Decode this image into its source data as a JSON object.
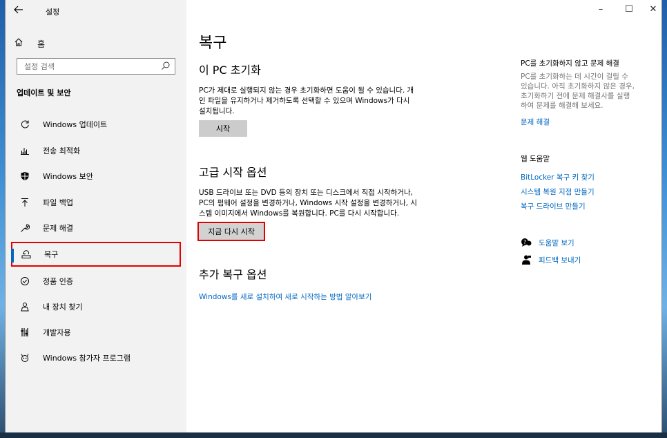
{
  "window": {
    "title": "설정",
    "back_icon": "arrow-left-icon",
    "minimize_glyph": "–",
    "maximize_glyph": "☐",
    "close_glyph": "✕"
  },
  "sidebar": {
    "home": {
      "label": "홈",
      "icon": "home-icon"
    },
    "search": {
      "placeholder": "설정 검색",
      "icon": "search-icon"
    },
    "section_title": "업데이트 및 보안",
    "items": [
      {
        "label": "Windows 업데이트",
        "icon": "sync-icon",
        "active": false
      },
      {
        "label": "전송 최적화",
        "icon": "delivery-icon",
        "active": false
      },
      {
        "label": "Windows 보안",
        "icon": "shield-icon",
        "active": false
      },
      {
        "label": "파일 백업",
        "icon": "backup-arrow-icon",
        "active": false
      },
      {
        "label": "문제 해결",
        "icon": "wrench-icon",
        "active": false
      },
      {
        "label": "복구",
        "icon": "recovery-icon",
        "active": true
      },
      {
        "label": "정품 인증",
        "icon": "check-circle-icon",
        "active": false
      },
      {
        "label": "내 장치 찾기",
        "icon": "find-device-icon",
        "active": false
      },
      {
        "label": "개발자용",
        "icon": "developer-icon",
        "active": false
      },
      {
        "label": "Windows 참가자 프로그램",
        "icon": "insider-icon",
        "active": false
      }
    ]
  },
  "main": {
    "title": "복구",
    "reset": {
      "heading": "이 PC 초기화",
      "description_lines": [
        "PC가 제대로 실행되지 않는 경우 초기화하면 도움이 될 수 있습니다. 개",
        "인 파일을 유지하거나 제거하도록 선택할 수 있으며 Windows가 다시",
        "설치됩니다."
      ],
      "button": "시작"
    },
    "advanced": {
      "heading": "고급 시작 옵션",
      "description_lines": [
        "USB 드라이브 또는 DVD 등의 장치 또는 디스크에서 직접 시작하거나,",
        "PC의 펌웨어 설정을 변경하거나, Windows 시작 설정을 변경하거나, 시",
        "스템 이미지에서 Windows를 복원합니다. PC를 다시 시작합니다."
      ],
      "button": "지금 다시 시작"
    },
    "more": {
      "heading": "추가 복구 옵션",
      "link": "Windows를 새로 설치하여 새로 시작하는 방법 알아보기"
    }
  },
  "right_panel": {
    "help_heading": "PC를 초기화하지 않고 문제 해결",
    "help_text_lines": [
      "PC를 초기화하는 데 시간이 걸릴 수",
      "있습니다. 아직 초기화하지 않은 경우,",
      "초기화하기 전에 문제 해결사를 실행",
      "하여 문제를 해결해 보세요."
    ],
    "troubleshoot_link": "문제 해결",
    "web_help_heading": "웹 도움말",
    "web_links": [
      "BitLocker 복구 키 찾기",
      "시스템 복원 지점 만들기",
      "복구 드라이브 만들기"
    ],
    "get_help": {
      "label": "도움말 보기",
      "icon": "help-chat-icon"
    },
    "feedback": {
      "label": "피드백 보내기",
      "icon": "feedback-icon"
    }
  },
  "colors": {
    "accent": "#0067c0",
    "highlight": "#e00000",
    "sidebar_bg": "#f2f2f2",
    "button_bg": "#cccccc"
  }
}
